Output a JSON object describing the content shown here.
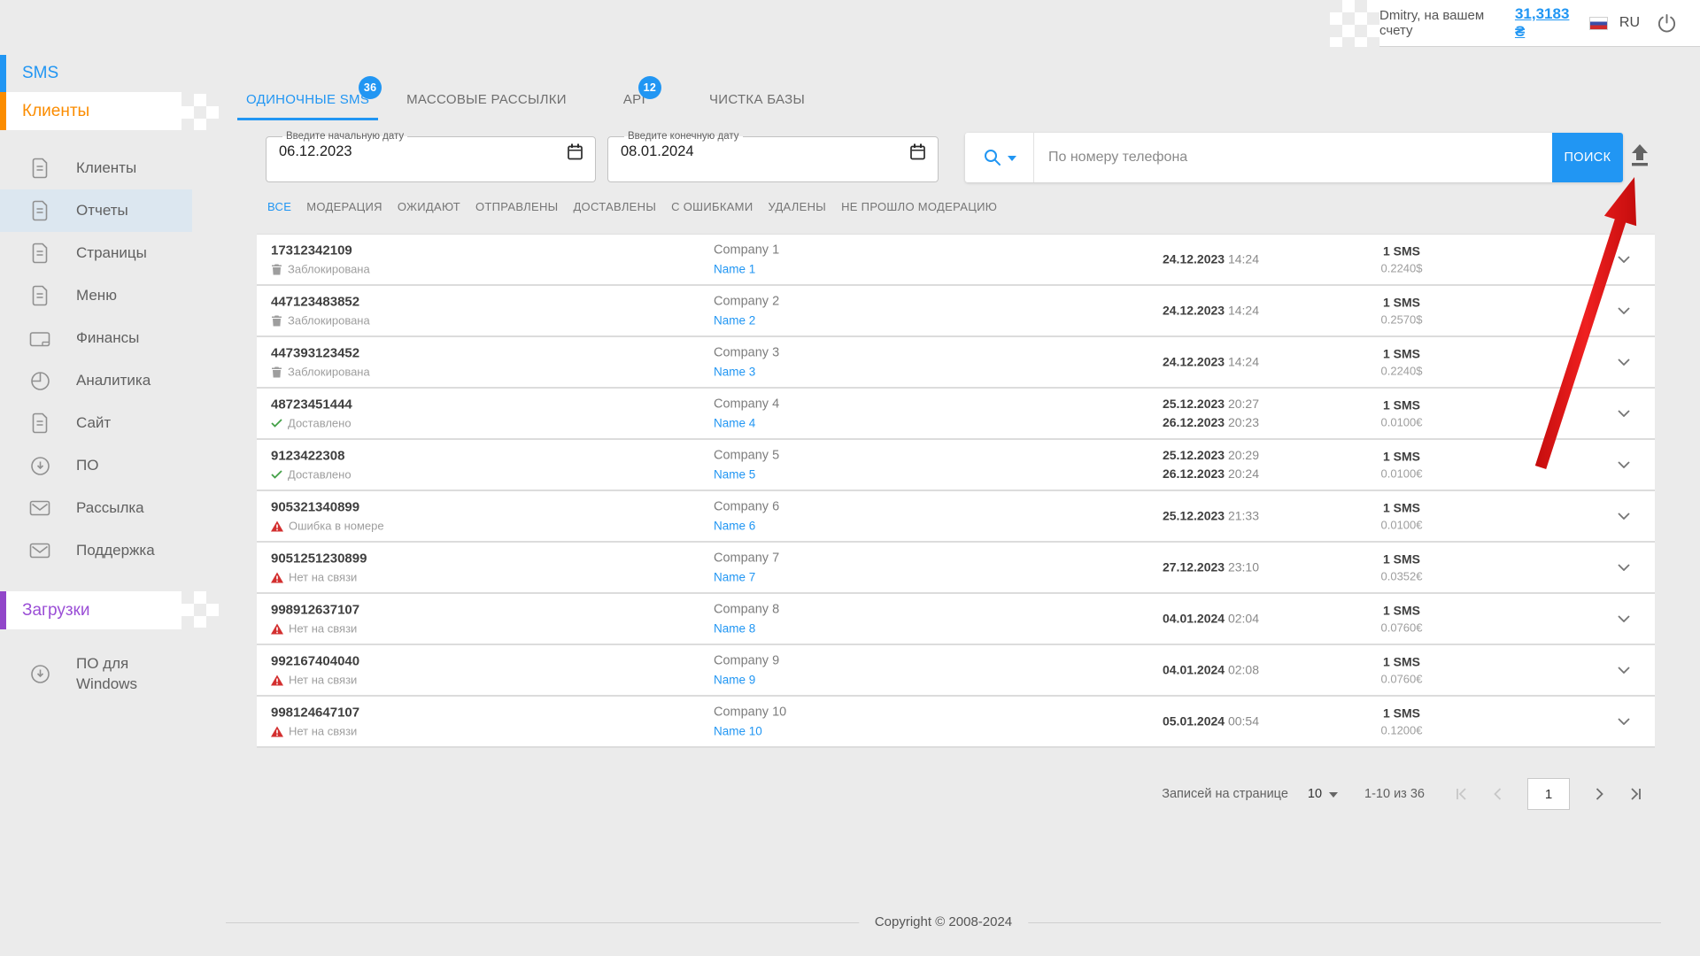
{
  "header": {
    "greeting": "Dmitry, на вашем счету",
    "balance": "31,3183 ₴",
    "language": "RU"
  },
  "sidebar": {
    "sms_section": "SMS",
    "clients_section": "Клиенты",
    "downloads_section": "Загрузки",
    "menu": [
      {
        "label": "Клиенты",
        "icon": "document"
      },
      {
        "label": "Отчеты",
        "icon": "document",
        "active": true
      },
      {
        "label": "Страницы",
        "icon": "document"
      },
      {
        "label": "Меню",
        "icon": "document"
      },
      {
        "label": "Финансы",
        "icon": "wallet"
      },
      {
        "label": "Аналитика",
        "icon": "pie-chart"
      },
      {
        "label": "Сайт",
        "icon": "document"
      },
      {
        "label": "ПО",
        "icon": "download"
      },
      {
        "label": "Рассылка",
        "icon": "envelope"
      },
      {
        "label": "Поддержка",
        "icon": "envelope"
      }
    ],
    "downloads_menu": [
      {
        "label": "ПО для Windows",
        "icon": "download"
      }
    ]
  },
  "tabs": [
    {
      "label": "ОДИНОЧНЫЕ SMS",
      "badge": "36",
      "active": true
    },
    {
      "label": "МАССОВЫЕ РАССЫЛКИ"
    },
    {
      "label": "API",
      "badge": "12"
    },
    {
      "label": "ЧИСТКА БАЗЫ"
    }
  ],
  "date_filters": {
    "start": {
      "label": "Введите начальную дату",
      "value": "06.12.2023"
    },
    "end": {
      "label": "Введите конечную дату",
      "value": "08.01.2024"
    }
  },
  "search": {
    "placeholder": "По номеру телефона",
    "button": "ПОИСК"
  },
  "status_filters": [
    {
      "label": "ВСЕ",
      "active": true
    },
    {
      "label": "МОДЕРАЦИЯ"
    },
    {
      "label": "ОЖИДАЮТ"
    },
    {
      "label": "ОТПРАВЛЕНЫ"
    },
    {
      "label": "ДОСТАВЛЕНЫ"
    },
    {
      "label": "С ОШИБКАМИ"
    },
    {
      "label": "УДАЛЕНЫ"
    },
    {
      "label": "НЕ ПРОШЛО МОДЕРАЦИЮ"
    }
  ],
  "rows": [
    {
      "phone": "17312342109",
      "status": "Заблокирована",
      "status_icon": "trash",
      "company": "Company 1",
      "name": "Name 1",
      "dates": [
        {
          "date": "24.12.2023",
          "time": "14:24"
        }
      ],
      "count": "1 SMS",
      "price": "0.2240$"
    },
    {
      "phone": "447123483852",
      "status": "Заблокирована",
      "status_icon": "trash",
      "company": "Company 2",
      "name": "Name 2",
      "dates": [
        {
          "date": "24.12.2023",
          "time": "14:24"
        }
      ],
      "count": "1 SMS",
      "price": "0.2570$"
    },
    {
      "phone": "447393123452",
      "status": "Заблокирована",
      "status_icon": "trash",
      "company": "Company 3",
      "name": "Name 3",
      "dates": [
        {
          "date": "24.12.2023",
          "time": "14:24"
        }
      ],
      "count": "1 SMS",
      "price": "0.2240$"
    },
    {
      "phone": "48723451444",
      "status": "Доставлено",
      "status_icon": "check",
      "company": "Company 4",
      "name": "Name 4",
      "dates": [
        {
          "date": "25.12.2023",
          "time": "20:27"
        },
        {
          "date": "26.12.2023",
          "time": "20:23"
        }
      ],
      "count": "1 SMS",
      "price": "0.0100€"
    },
    {
      "phone": "9123422308",
      "status": "Доставлено",
      "status_icon": "check",
      "company": "Company 5",
      "name": "Name 5",
      "dates": [
        {
          "date": "25.12.2023",
          "time": "20:29"
        },
        {
          "date": "26.12.2023",
          "time": "20:24"
        }
      ],
      "count": "1 SMS",
      "price": "0.0100€"
    },
    {
      "phone": "905321340899",
      "status": "Ошибка в номере",
      "status_icon": "warning",
      "company": "Company 6",
      "name": "Name 6",
      "dates": [
        {
          "date": "25.12.2023",
          "time": "21:33"
        }
      ],
      "count": "1 SMS",
      "price": "0.0100€"
    },
    {
      "phone": "9051251230899",
      "status": "Нет на связи",
      "status_icon": "warning",
      "company": "Company 7",
      "name": "Name 7",
      "dates": [
        {
          "date": "27.12.2023",
          "time": "23:10"
        }
      ],
      "count": "1 SMS",
      "price": "0.0352€"
    },
    {
      "phone": "998912637107",
      "status": "Нет на связи",
      "status_icon": "warning",
      "company": "Company 8",
      "name": "Name 8",
      "dates": [
        {
          "date": "04.01.2024",
          "time": "02:04"
        }
      ],
      "count": "1 SMS",
      "price": "0.0760€"
    },
    {
      "phone": "992167404040",
      "status": "Нет на связи",
      "status_icon": "warning",
      "company": "Company 9",
      "name": "Name 9",
      "dates": [
        {
          "date": "04.01.2024",
          "time": "02:08"
        }
      ],
      "count": "1 SMS",
      "price": "0.0760€"
    },
    {
      "phone": "998124647107",
      "status": "Нет на связи",
      "status_icon": "warning",
      "company": "Company 10",
      "name": "Name 10",
      "dates": [
        {
          "date": "05.01.2024",
          "time": "00:54"
        }
      ],
      "count": "1 SMS",
      "price": "0.1200€"
    }
  ],
  "pagination": {
    "per_page_label": "Записей на странице",
    "per_page": "10",
    "range": "1-10 из 36",
    "page": "1"
  },
  "footer": {
    "copyright": "Copyright © 2008-2024"
  },
  "colors": {
    "accent_blue": "#2196f3",
    "clients_orange": "#fb8c00",
    "downloads_purple": "#9146c9",
    "success_green": "#43a047",
    "error_red": "#d32f2f",
    "annotation_arrow_red": "#e01111",
    "background": "#ebebeb"
  }
}
